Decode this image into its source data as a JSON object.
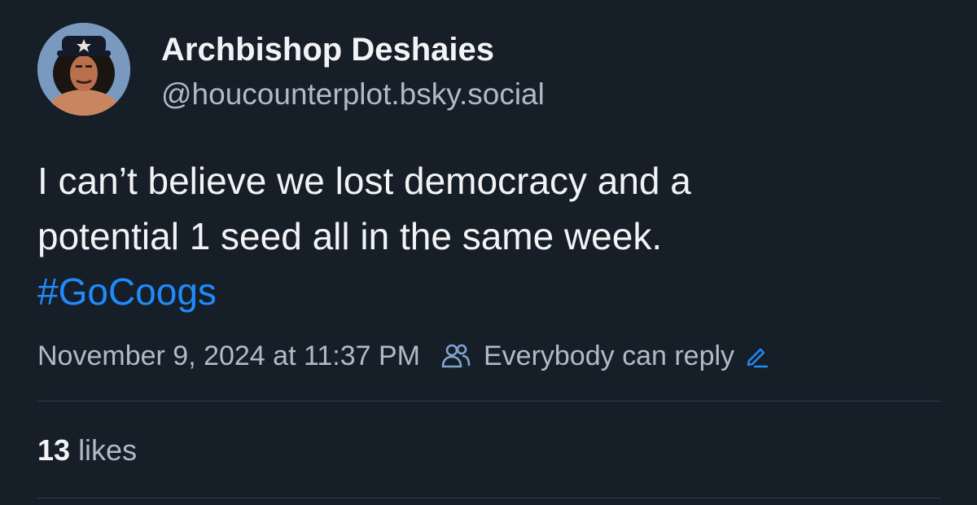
{
  "author": {
    "display_name": "Archbishop Deshaies",
    "handle": "@houcounterplot.bsky.social"
  },
  "post": {
    "text_line_1": "I can’t believe we lost democracy and a",
    "text_line_2": "potential 1 seed all in the same week.",
    "hashtag": "#GoCoogs"
  },
  "meta": {
    "timestamp": "November 9, 2024 at 11:37 PM",
    "reply_setting": "Everybody can reply"
  },
  "likes": {
    "count": "13",
    "label": "likes"
  },
  "colors": {
    "background": "#161e27",
    "text_primary": "#f1f3f5",
    "text_secondary": "#aebbc9",
    "accent": "#208bfe",
    "divider": "#2e3a48"
  },
  "icons": {
    "reply_setting_icon": "people-icon",
    "edit_icon": "pencil-icon"
  }
}
